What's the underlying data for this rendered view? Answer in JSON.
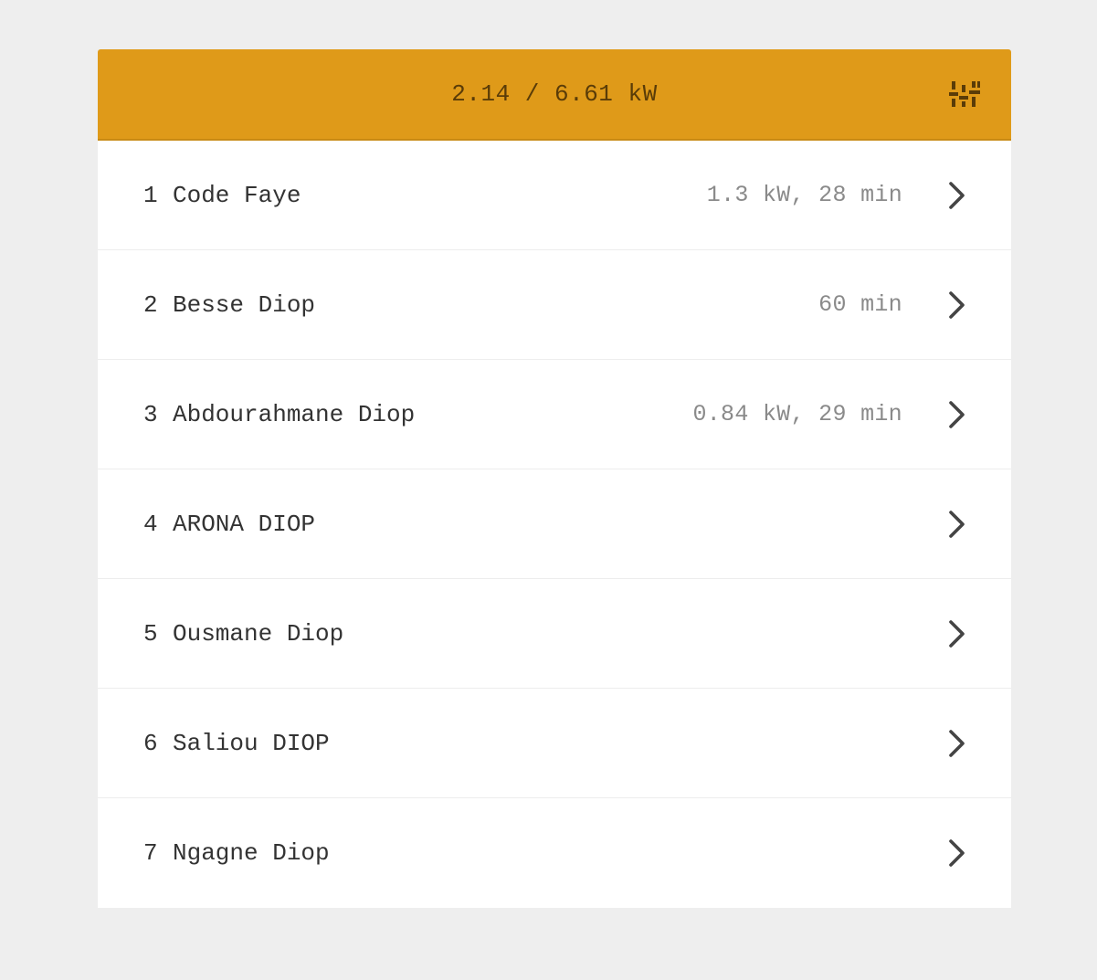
{
  "header": {
    "title": "2.14 / 6.61 kW",
    "settings_icon": "sliders-icon",
    "background_color": "#df9a19"
  },
  "rows": [
    {
      "num": "1",
      "name": "Code Faye",
      "info": "1.3 kW, 28 min"
    },
    {
      "num": "2",
      "name": "Besse Diop",
      "info": "60 min"
    },
    {
      "num": "3",
      "name": "Abdourahmane Diop",
      "info": "0.84 kW, 29 min"
    },
    {
      "num": "4",
      "name": "ARONA DIOP",
      "info": ""
    },
    {
      "num": "5",
      "name": "Ousmane Diop",
      "info": ""
    },
    {
      "num": "6",
      "name": "Saliou DIOP",
      "info": ""
    },
    {
      "num": "7",
      "name": "Ngagne Diop",
      "info": ""
    }
  ],
  "row_icon": "chevron-right-icon"
}
